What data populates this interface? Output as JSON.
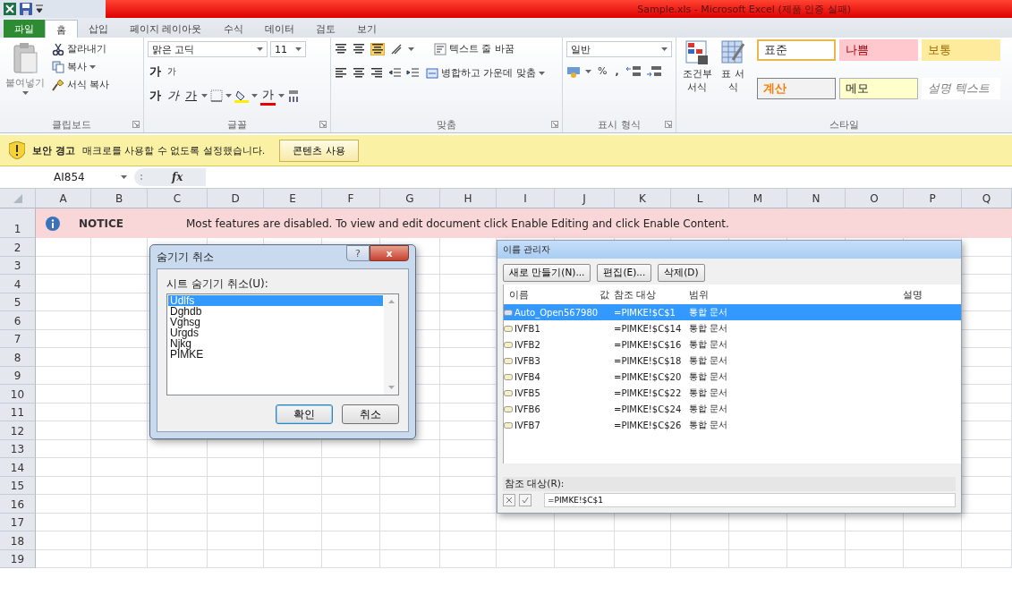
{
  "title_bar": {
    "title": "Sample.xls  -  Microsoft Excel (제품 인증 실패)"
  },
  "ribbon_tabs": [
    {
      "label": "파일",
      "kind": "file",
      "selected": false
    },
    {
      "label": "홈",
      "kind": "tab",
      "selected": true
    },
    {
      "label": "삽입",
      "kind": "tab",
      "selected": false
    },
    {
      "label": "페이지 레이아웃",
      "kind": "tab",
      "selected": false
    },
    {
      "label": "수식",
      "kind": "tab",
      "selected": false
    },
    {
      "label": "데이터",
      "kind": "tab",
      "selected": false
    },
    {
      "label": "검토",
      "kind": "tab",
      "selected": false
    },
    {
      "label": "보기",
      "kind": "tab",
      "selected": false
    }
  ],
  "ribbon": {
    "clipboard": {
      "paste": "붙여넣기",
      "cut": "잘라내기",
      "copy": "복사",
      "format_painter": "서식 복사",
      "label": "클립보드"
    },
    "font": {
      "font_name": "맑은 고딕",
      "font_size": "11",
      "grow": "가",
      "shrink": "가",
      "bold": "가",
      "italic": "가",
      "underline": "가",
      "font_color": "가",
      "label": "글꼴"
    },
    "alignment": {
      "wrap_text": "텍스트 줄 바꿈",
      "merge_center": "병합하고 가운데 맞춤",
      "label": "맞춤"
    },
    "number": {
      "format": "일반",
      "percent": "%",
      "comma": ",",
      "label": "표시 형식"
    },
    "styles": {
      "conditional_formatting": "조건부 서식",
      "format_as_table": "표 서식",
      "label": "스타일",
      "cell_styles": [
        {
          "label": "표준",
          "kind": "normal",
          "selected": true
        },
        {
          "label": "나쁨",
          "kind": "bad",
          "selected": false
        },
        {
          "label": "보통",
          "kind": "neutral",
          "selected": false
        },
        {
          "label": "계산",
          "kind": "calculation",
          "selected": false
        },
        {
          "label": "메모",
          "kind": "note",
          "selected": false
        },
        {
          "label": "설명 텍스트",
          "kind": "explanatory",
          "selected": false
        }
      ]
    }
  },
  "security_bar": {
    "title": "보안 경고",
    "message": "매크로를 사용할 수 없도록 설정했습니다.",
    "button": "콘텐츠 사용"
  },
  "formula_bar": {
    "name_box": "AI854",
    "fx": "fx"
  },
  "sheet": {
    "columns": [
      "A",
      "B",
      "C",
      "D",
      "E",
      "F",
      "G",
      "H",
      "I",
      "J",
      "K",
      "L",
      "M",
      "N",
      "O",
      "P",
      "Q"
    ],
    "rows": [
      "1",
      "2",
      "3",
      "4",
      "5",
      "6",
      "7",
      "8",
      "9",
      "10",
      "11",
      "12",
      "13",
      "14",
      "15",
      "16",
      "17",
      "18",
      "19"
    ],
    "notice": {
      "label": "NOTICE",
      "message": "Most features are disabled. To view and edit document click Enable Editing and click Enable Content."
    }
  },
  "unhide_dialog": {
    "title": "숨기기 취소",
    "help": "?",
    "close": "x",
    "label": "시트 숨기기 취소(U):",
    "sheets": [
      {
        "name": "Udlfs",
        "selected": true
      },
      {
        "name": "Dghdb",
        "selected": false
      },
      {
        "name": "Vghsg",
        "selected": false
      },
      {
        "name": "Urgds",
        "selected": false
      },
      {
        "name": "Njkg",
        "selected": false
      },
      {
        "name": "PIMKE",
        "selected": false
      }
    ],
    "buttons": [
      {
        "label": "확인",
        "kind": "default"
      },
      {
        "label": "취소",
        "kind": "normal"
      }
    ]
  },
  "name_manager": {
    "title": "이름 관리자",
    "buttons": [
      "새로 만들기(N)...",
      "편집(E)...",
      "삭제(D)"
    ],
    "columns": [
      "이름",
      "값",
      "참조 대상",
      "범위",
      "설명"
    ],
    "names": [
      {
        "name": "Auto_Open567980",
        "refers_to": "=PIMKE!$C$1",
        "scope": "통합 문서",
        "selected": true
      },
      {
        "name": "IVFB1",
        "refers_to": "=PIMKE!$C$14",
        "scope": "통합 문서",
        "selected": false
      },
      {
        "name": "IVFB2",
        "refers_to": "=PIMKE!$C$16",
        "scope": "통합 문서",
        "selected": false
      },
      {
        "name": "IVFB3",
        "refers_to": "=PIMKE!$C$18",
        "scope": "통합 문서",
        "selected": false
      },
      {
        "name": "IVFB4",
        "refers_to": "=PIMKE!$C$20",
        "scope": "통합 문서",
        "selected": false
      },
      {
        "name": "IVFB5",
        "refers_to": "=PIMKE!$C$22",
        "scope": "통합 문서",
        "selected": false
      },
      {
        "name": "IVFB6",
        "refers_to": "=PIMKE!$C$24",
        "scope": "통합 문서",
        "selected": false
      },
      {
        "name": "IVFB7",
        "refers_to": "=PIMKE!$C$26",
        "scope": "통합 문서",
        "selected": false
      }
    ],
    "refers_label": "참조 대상(R):",
    "refers_value": "=PIMKE!$C$1"
  }
}
